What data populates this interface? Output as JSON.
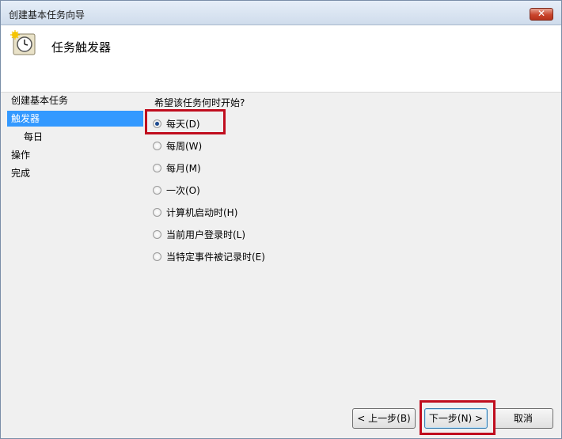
{
  "window": {
    "title": "创建基本任务向导",
    "close_label": "✕"
  },
  "header": {
    "title": "任务触发器"
  },
  "sidebar": {
    "items": [
      {
        "label": "创建基本任务"
      },
      {
        "label": "触发器"
      },
      {
        "label": "每日"
      },
      {
        "label": "操作"
      },
      {
        "label": "完成"
      }
    ],
    "active_index": 1
  },
  "content": {
    "question": "希望该任务何时开始?",
    "options": [
      {
        "label": "每天(D)",
        "selected": true
      },
      {
        "label": "每周(W)",
        "selected": false
      },
      {
        "label": "每月(M)",
        "selected": false
      },
      {
        "label": "一次(O)",
        "selected": false
      },
      {
        "label": "计算机启动时(H)",
        "selected": false
      },
      {
        "label": "当前用户登录时(L)",
        "selected": false
      },
      {
        "label": "当特定事件被记录时(E)",
        "selected": false
      }
    ]
  },
  "buttons": {
    "back": "< 上一步(B)",
    "next": "下一步(N) >",
    "cancel": "取消"
  },
  "colors": {
    "highlight": "#c00d1e",
    "selection": "#3399ff"
  }
}
